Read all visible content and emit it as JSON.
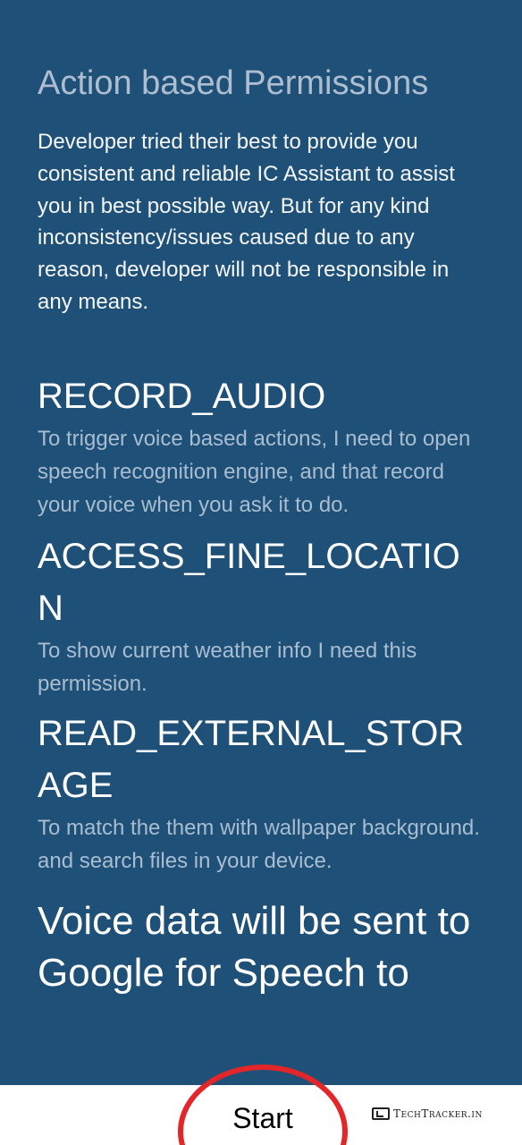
{
  "title": "Action based Permissions",
  "disclaimer": "Developer tried their best to provide you consistent and reliable IC Assistant to assist you in best possible way. But for any kind inconsistency/issues caused due to any reason, developer will not be responsible in any means.",
  "permissions": [
    {
      "name": "RECORD_AUDIO",
      "description": "To trigger voice based actions, I need to open speech recognition engine, and that record your voice when you ask it to do."
    },
    {
      "name": "ACCESS_FINE_LOCATION",
      "description": "To show current weather info I need this permission."
    },
    {
      "name": "READ_EXTERNAL_STORAGE",
      "description": "To match the them with wallpaper background. and search files in your device."
    }
  ],
  "voice_note": "Voice data will be sent to Google for Speech to",
  "start_label": "Start",
  "watermark": {
    "text": "TechTracker.in",
    "icon": "browser-window-icon"
  },
  "colors": {
    "background": "#1f5078",
    "title": "#aebed0",
    "description": "#a9bdd0",
    "annotation_circle": "#e3262a"
  }
}
